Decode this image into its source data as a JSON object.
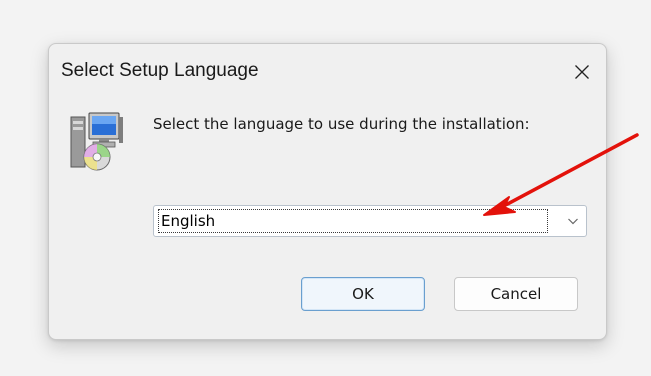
{
  "dialog": {
    "title": "Select Setup Language",
    "close_icon": "close-icon",
    "app_icon": "setup-installer-icon",
    "prompt": "Select the language to use during the installation:",
    "language_select": {
      "selected": "English"
    },
    "buttons": {
      "ok": "OK",
      "cancel": "Cancel"
    }
  },
  "annotation": {
    "arrow_color": "#e3120b"
  },
  "colors": {
    "dialog_bg": "#f0f0f0",
    "ok_border": "#6a9fcf"
  }
}
